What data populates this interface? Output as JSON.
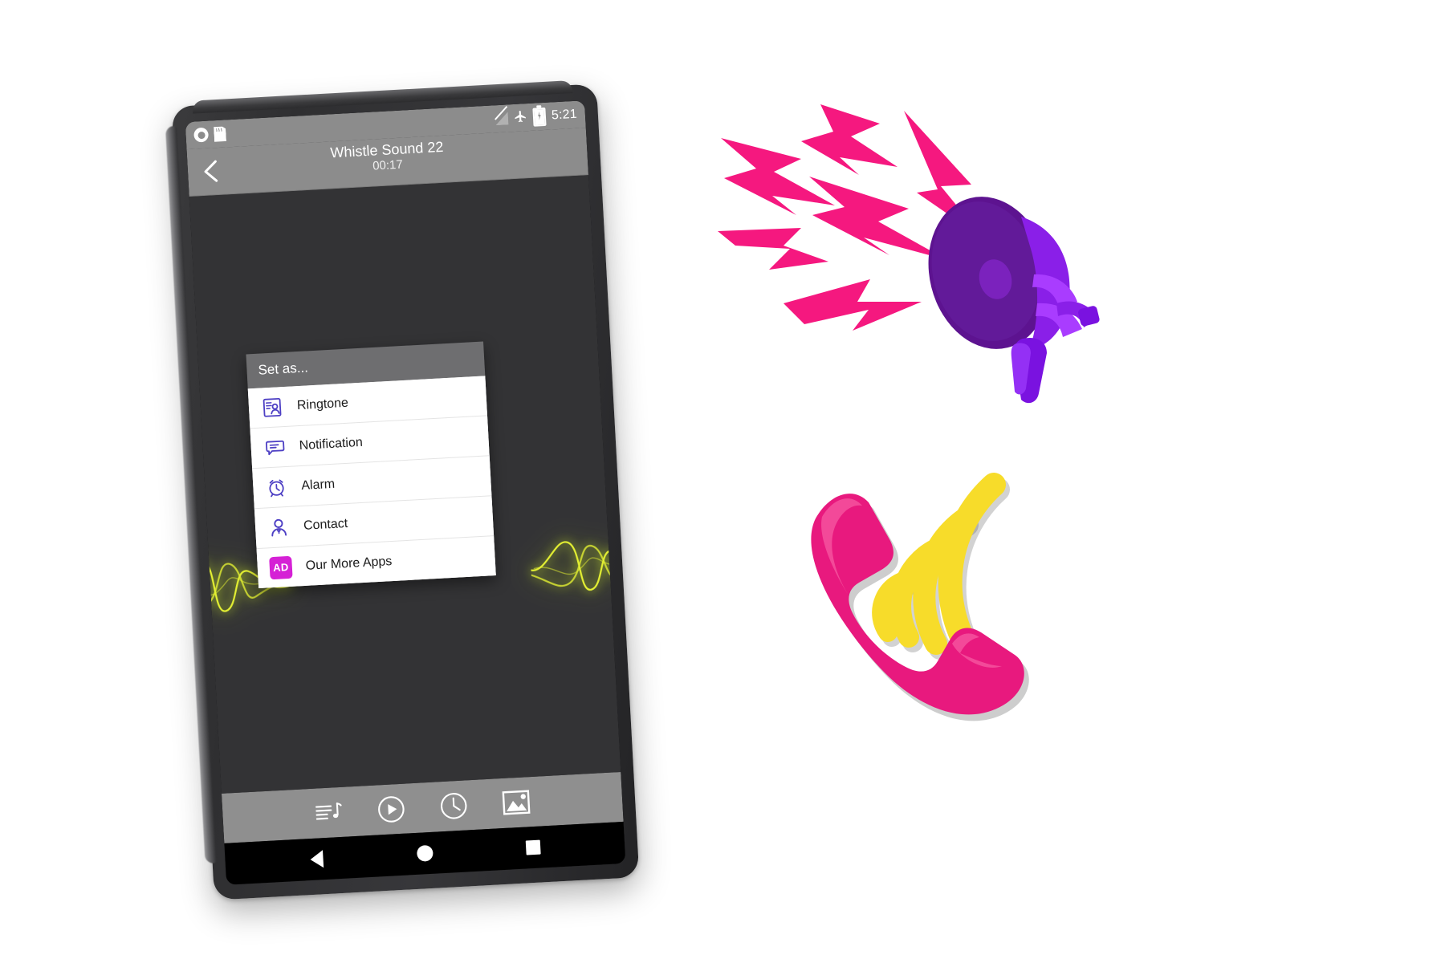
{
  "page": {
    "background_color": "#ffffff"
  },
  "device": {
    "name": "android-tablet",
    "frame_color": "#313133",
    "screen_background": "#333335"
  },
  "status_bar": {
    "background_color": "#8c8c8c",
    "left_icons": [
      {
        "name": "screen-record-icon",
        "glyph": "record"
      },
      {
        "name": "sd-card-icon",
        "glyph": "sd-card"
      }
    ],
    "right_icons": [
      {
        "name": "signal-off-icon",
        "glyph": "no-signal"
      },
      {
        "name": "airplane-mode-icon",
        "glyph": "airplane"
      },
      {
        "name": "battery-charging-icon",
        "glyph": "battery-bolt"
      }
    ],
    "time": "5:21"
  },
  "app_bar": {
    "back_icon": "chevron-left-icon",
    "title": "Whistle Sound 22",
    "duration": "00:17",
    "background_color": "#8c8c8c",
    "text_color": "#ffffff"
  },
  "dialog": {
    "header": "Set as...",
    "header_background": "#6e6e70",
    "body_background": "#ffffff",
    "accent_color": "#4d3fc4",
    "items": [
      {
        "label": "Ringtone",
        "icon": "contact-card-icon"
      },
      {
        "label": "Notification",
        "icon": "chat-bubble-icon"
      },
      {
        "label": "Alarm",
        "icon": "alarm-clock-icon"
      },
      {
        "label": "Contact",
        "icon": "person-icon"
      },
      {
        "label": "Our More Apps",
        "icon": "ad-badge-icon",
        "badge_text": "AD",
        "badge_color": "#d521d5"
      }
    ]
  },
  "tool_bar": {
    "background_color": "#8f8f8f",
    "buttons": [
      {
        "name": "playlist-button",
        "icon": "music-list-icon"
      },
      {
        "name": "play-button",
        "icon": "play-circle-icon"
      },
      {
        "name": "timer-button",
        "icon": "clock-icon"
      },
      {
        "name": "gallery-button",
        "icon": "image-icon"
      }
    ]
  },
  "nav_bar": {
    "background_color": "#000000",
    "buttons": [
      {
        "name": "nav-back-button",
        "icon": "triangle-back-icon"
      },
      {
        "name": "nav-home-button",
        "icon": "circle-home-icon"
      },
      {
        "name": "nav-recent-button",
        "icon": "square-recents-icon"
      }
    ]
  },
  "decorations": {
    "waveform_color": "#e4f033",
    "waveform_positions": [
      "left",
      "right"
    ]
  },
  "artwork": {
    "megaphone": {
      "name": "megaphone-illustration",
      "horn_color": "#6b1fa8",
      "body_color": "#7a12e0",
      "bolt_color": "#f5187f",
      "bolt_count": 6
    },
    "phone_ringing": {
      "name": "ringing-phone-illustration",
      "handset_color": "#e8197e",
      "wave_color": "#f7dc2a",
      "wave_count": 4
    }
  }
}
